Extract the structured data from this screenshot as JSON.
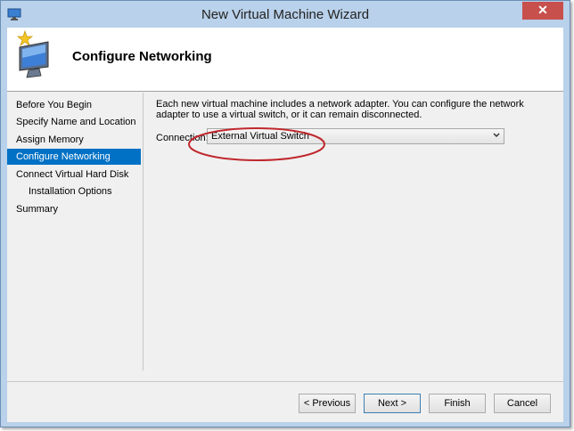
{
  "window": {
    "title": "New Virtual Machine Wizard",
    "close_glyph": "✕"
  },
  "header": {
    "title": "Configure Networking",
    "icon": "monitor-star-icon"
  },
  "nav": {
    "items": [
      {
        "label": "Before You Begin",
        "selected": false,
        "indent": false
      },
      {
        "label": "Specify Name and Location",
        "selected": false,
        "indent": false
      },
      {
        "label": "Assign Memory",
        "selected": false,
        "indent": false
      },
      {
        "label": "Configure Networking",
        "selected": true,
        "indent": false
      },
      {
        "label": "Connect Virtual Hard Disk",
        "selected": false,
        "indent": false
      },
      {
        "label": "Installation Options",
        "selected": false,
        "indent": true
      },
      {
        "label": "Summary",
        "selected": false,
        "indent": false
      }
    ]
  },
  "content": {
    "description": "Each new virtual machine includes a network adapter. You can configure the network adapter to use a virtual switch, or it can remain disconnected.",
    "connection_label": "Connection:",
    "connection_value": "External Virtual Switch"
  },
  "buttons": {
    "previous": "< Previous",
    "next": "Next >",
    "finish": "Finish",
    "cancel": "Cancel"
  },
  "colors": {
    "selection": "#0071c5",
    "annotation": "#c0282d",
    "close": "#c7504d"
  }
}
